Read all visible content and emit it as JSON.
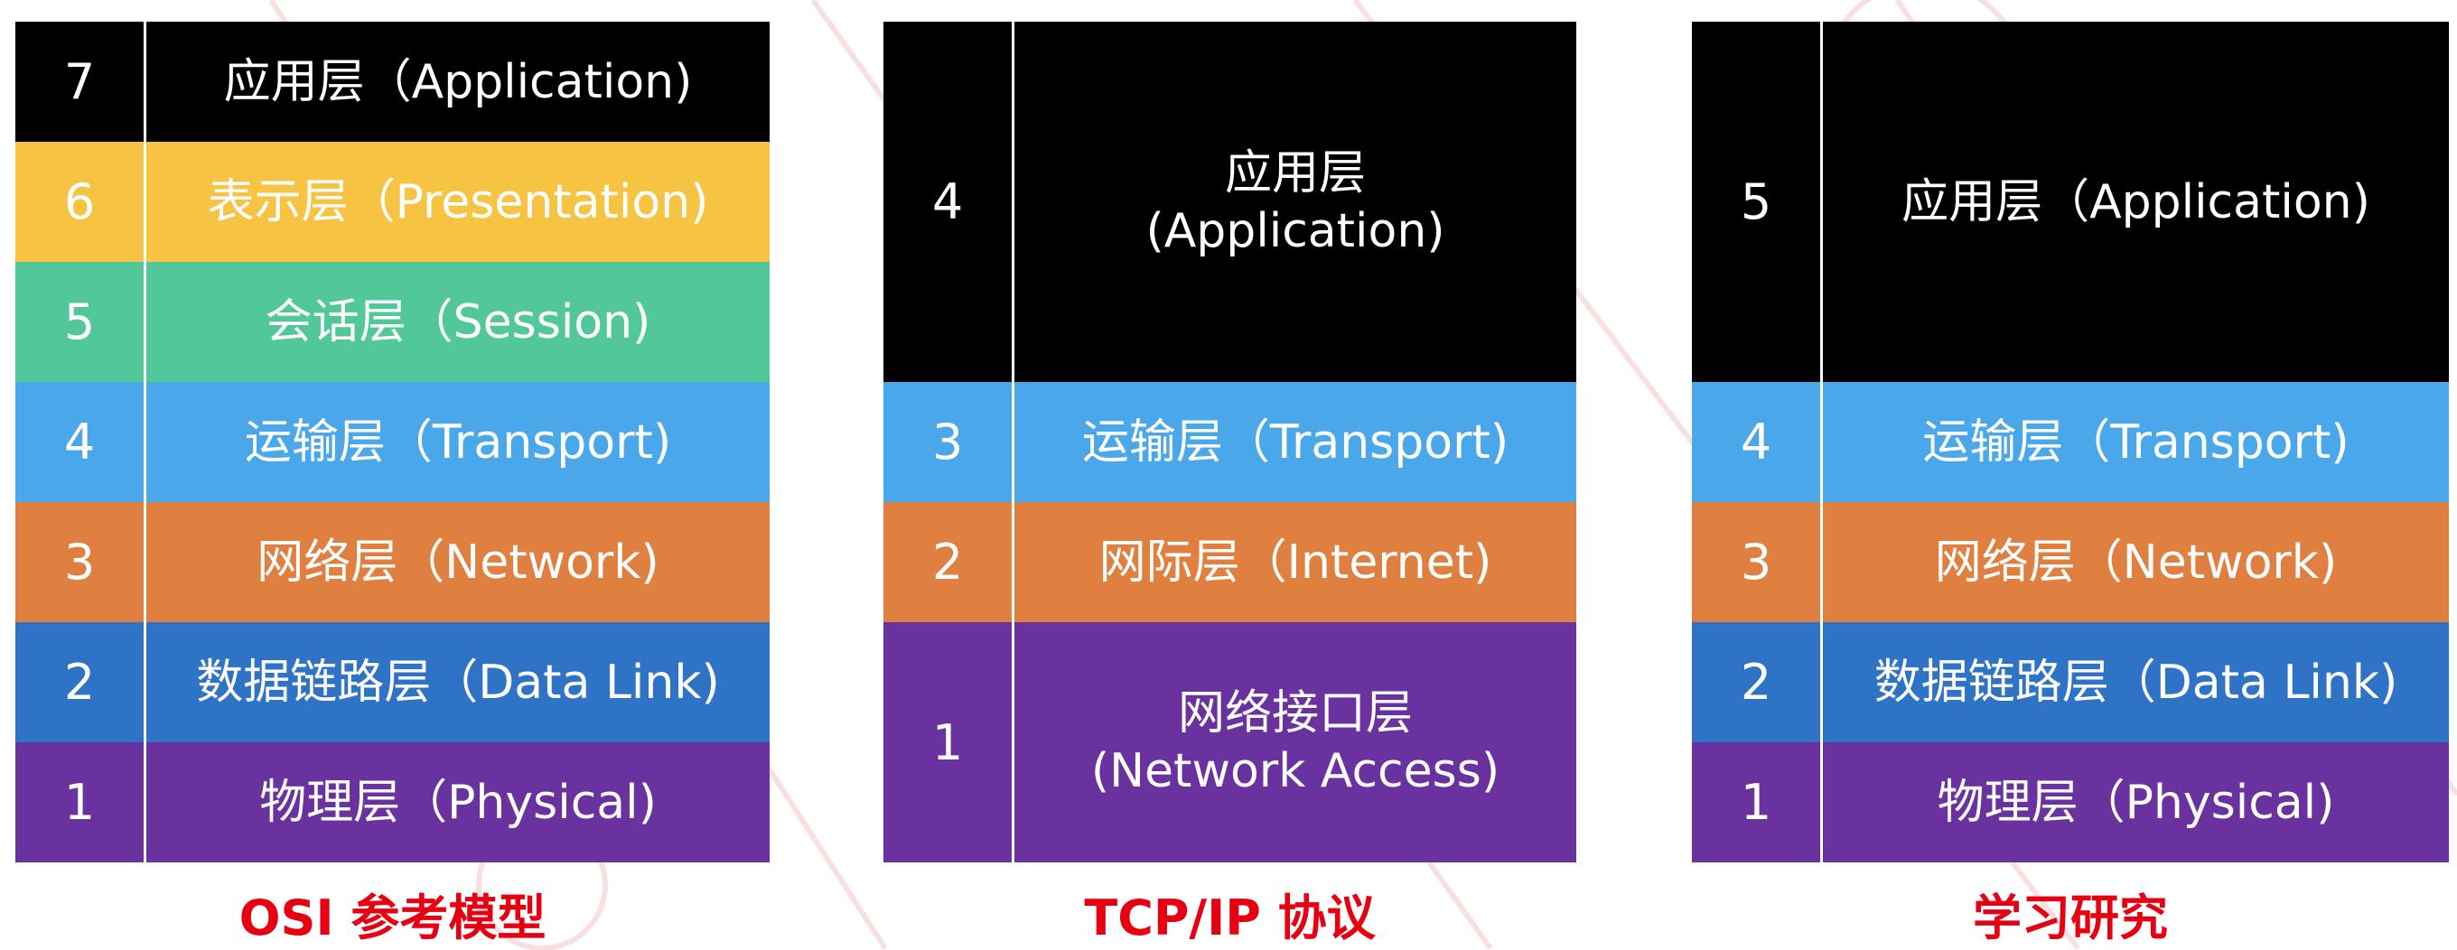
{
  "colors": {
    "application": "#000000",
    "presentation": "#f6c342",
    "session": "#52c89a",
    "transport": "#4aa8ea",
    "network": "#e08040",
    "datalink": "#2f73c6",
    "physical": "#6a329f",
    "caption": "#e60012"
  },
  "osi": {
    "caption": "OSI 参考模型",
    "layers": [
      {
        "num": "7",
        "label": "应用层（Application)",
        "color": "#000000"
      },
      {
        "num": "6",
        "label": "表示层（Presentation)",
        "color": "#f6c342"
      },
      {
        "num": "5",
        "label": "会话层（Session)",
        "color": "#52c89a"
      },
      {
        "num": "4",
        "label": "运输层（Transport)",
        "color": "#4aa8ea"
      },
      {
        "num": "3",
        "label": "网络层（Network)",
        "color": "#e08040"
      },
      {
        "num": "2",
        "label": "数据链路层（Data Link)",
        "color": "#2f73c6"
      },
      {
        "num": "1",
        "label": "物理层（Physical)",
        "color": "#6a329f"
      }
    ]
  },
  "tcpip": {
    "caption": "TCP/IP 协议",
    "layers": [
      {
        "num": "4",
        "label": "应用层\n(Application)",
        "color": "#000000"
      },
      {
        "num": "3",
        "label": "运输层（Transport)",
        "color": "#4aa8ea"
      },
      {
        "num": "2",
        "label": "网际层（Internet)",
        "color": "#e08040"
      },
      {
        "num": "1",
        "label": "网络接口层\n(Network Access)",
        "color": "#6a329f"
      }
    ]
  },
  "study": {
    "caption": "学习研究",
    "layers": [
      {
        "num": "5",
        "label": "应用层（Application)",
        "color": "#000000"
      },
      {
        "num": "4",
        "label": "运输层（Transport)",
        "color": "#4aa8ea"
      },
      {
        "num": "3",
        "label": "网络层（Network)",
        "color": "#e08040"
      },
      {
        "num": "2",
        "label": "数据链路层（Data Link)",
        "color": "#2f73c6"
      },
      {
        "num": "1",
        "label": "物理层（Physical)",
        "color": "#6a329f"
      }
    ]
  }
}
